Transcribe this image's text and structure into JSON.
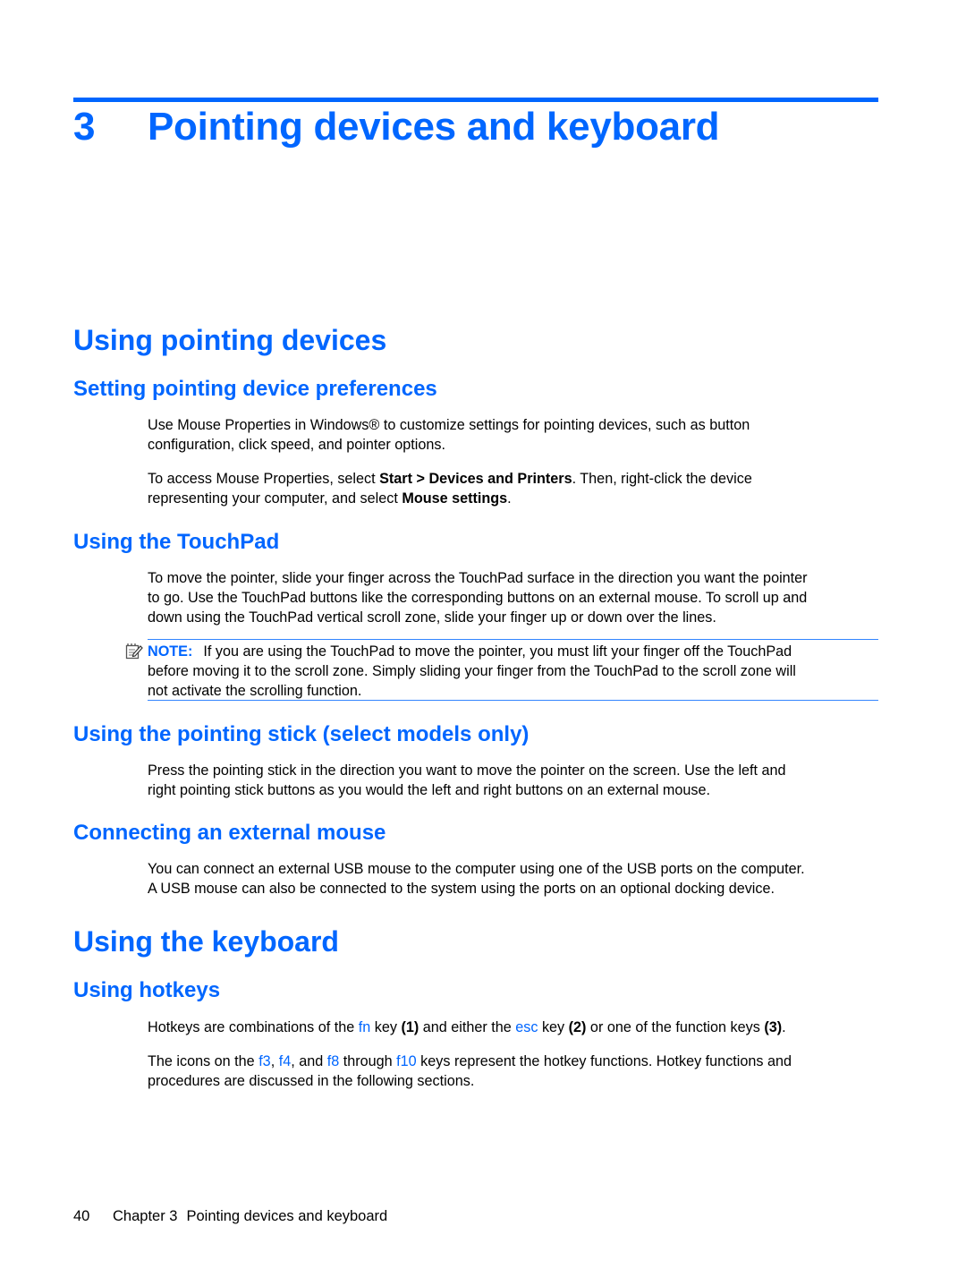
{
  "chapter": {
    "number": "3",
    "title": "Pointing devices and keyboard"
  },
  "sections": {
    "pointing": {
      "title": "Using pointing devices",
      "preferences": {
        "title": "Setting pointing device preferences",
        "p1_line1": "Use Mouse Properties in Windows® to customize settings for pointing devices, such as button",
        "p1_line2": "configuration, click speed, and pointer options.",
        "p2_a": "To access Mouse Properties, select ",
        "p2_b": "Start > Devices and Printers",
        "p2_c": ". Then, right-click the device",
        "p2_d": "representing your computer, and select ",
        "p2_e": "Mouse settings",
        "p2_f": "."
      },
      "touchpad": {
        "title": "Using the TouchPad",
        "line1": "To move the pointer, slide your finger across the TouchPad surface in the direction you want the pointer",
        "line2": "to go. Use the TouchPad buttons like the corresponding buttons on an external mouse. To scroll up and",
        "line3": "down using the TouchPad vertical scroll zone, slide your finger up or down over the lines.",
        "note_label": "NOTE:",
        "note_line1": "If you are using the TouchPad to move the pointer, you must lift your finger off the TouchPad",
        "note_line2": "before moving it to the scroll zone. Simply sliding your finger from the TouchPad to the scroll zone will",
        "note_line3": "not activate the scrolling function.",
        "note_icon": "note-pencil-icon"
      },
      "stick": {
        "title": "Using the pointing stick (select models only)",
        "line1": "Press the pointing stick in the direction you want to move the pointer on the screen. Use the left and",
        "line2": "right pointing stick buttons as you would the left and right buttons on an external mouse."
      },
      "mouse": {
        "title": "Connecting an external mouse",
        "line1": "You can connect an external USB mouse to the computer using one of the USB ports on the computer.",
        "line2": "A USB mouse can also be connected to the system using the ports on an optional docking device."
      }
    },
    "keyboard": {
      "title": "Using the keyboard",
      "hotkeys": {
        "title": "Using hotkeys",
        "p1": {
          "a": "Hotkeys are combinations of the ",
          "fn": "fn",
          "b": " key ",
          "n1": "(1)",
          "c": " and either the ",
          "esc": "esc",
          "d": " key ",
          "n2": "(2)",
          "e": " or one of the function keys ",
          "n3": "(3)",
          "f": "."
        },
        "p2": {
          "a": "The icons on the ",
          "f3": "f3",
          "b": ", ",
          "f4": "f4",
          "c": ", and ",
          "f8": "f8",
          "d": " through ",
          "f10": "f10",
          "e": " keys represent the hotkey functions. Hotkey functions and",
          "line2": "procedures are discussed in the following sections."
        }
      }
    }
  },
  "footer": {
    "page_number": "40",
    "chapter_label": "Chapter 3",
    "chapter_title": "Pointing devices and keyboard"
  },
  "colors": {
    "accent": "#0066ff",
    "text": "#000000"
  }
}
